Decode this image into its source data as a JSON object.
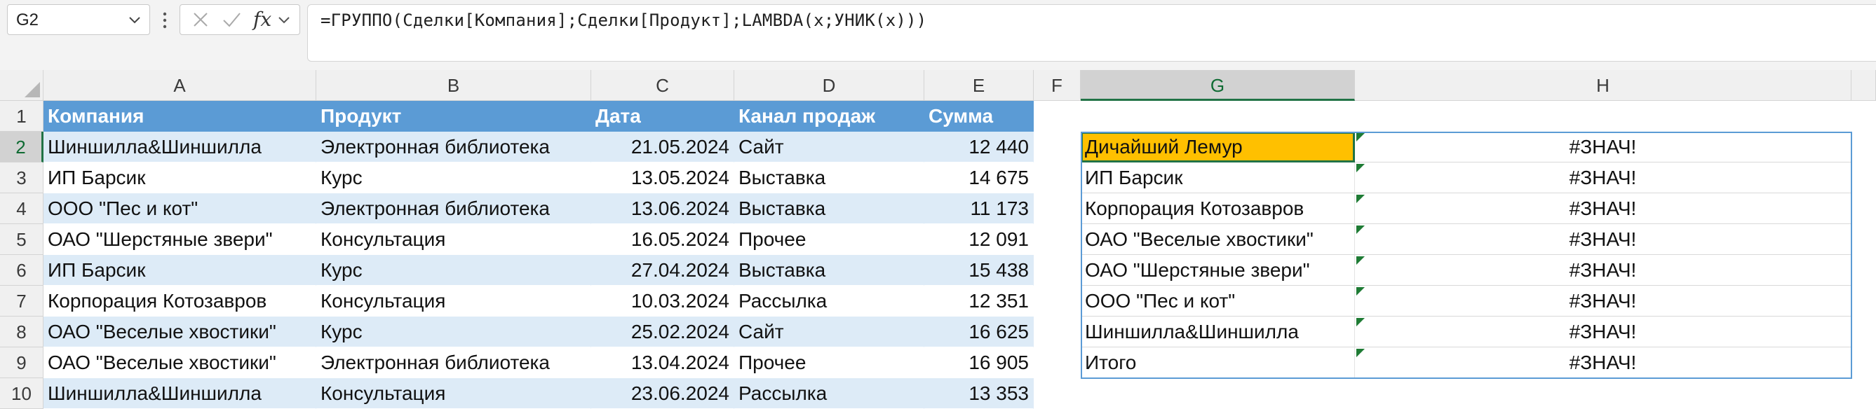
{
  "formula_bar": {
    "name_box": "G2",
    "formula": "=ГРУППО(Сделки[Компания];Сделки[Продукт];LAMBDA(x;УНИК(x)))",
    "fx_label": "fx"
  },
  "columns": [
    "A",
    "B",
    "C",
    "D",
    "E",
    "F",
    "G",
    "H"
  ],
  "rows": [
    "1",
    "2",
    "3",
    "4",
    "5",
    "6",
    "7",
    "8",
    "9",
    "10"
  ],
  "table": {
    "headers": [
      "Компания",
      "Продукт",
      "Дата",
      "Канал продаж",
      "Сумма"
    ],
    "rows": [
      [
        "Шиншилла&Шиншилла",
        "Электронная библиотека",
        "21.05.2024",
        "Сайт",
        "12 440"
      ],
      [
        "ИП Барсик",
        "Курс",
        "13.05.2024",
        "Выставка",
        "14 675"
      ],
      [
        "ООО \"Пес и кот\"",
        "Электронная библиотека",
        "13.06.2024",
        "Выставка",
        "11 173"
      ],
      [
        "ОАО \"Шерстяные звери\"",
        "Консультация",
        "16.05.2024",
        "Прочее",
        "12 091"
      ],
      [
        "ИП Барсик",
        "Курс",
        "27.04.2024",
        "Выставка",
        "15 438"
      ],
      [
        "Корпорация Котозавров",
        "Консультация",
        "10.03.2024",
        "Рассылка",
        "12 351"
      ],
      [
        "ОАО \"Веселые хвостики\"",
        "Курс",
        "25.02.2024",
        "Сайт",
        "16 625"
      ],
      [
        "ОАО \"Веселые хвостики\"",
        "Электронная библиотека",
        "13.04.2024",
        "Прочее",
        "16 905"
      ],
      [
        "Шиншилла&Шиншилла",
        "Консультация",
        "23.06.2024",
        "Рассылка",
        "13 353"
      ]
    ]
  },
  "result": {
    "g": [
      "Дичайший Лемур",
      "ИП Барсик",
      "Корпорация Котозавров",
      "ОАО \"Веселые хвостики\"",
      "ОАО \"Шерстяные звери\"",
      "ООО \"Пес и кот\"",
      "Шиншилла&Шиншилла",
      "Итого"
    ],
    "h": [
      "#ЗНАЧ!",
      "#ЗНАЧ!",
      "#ЗНАЧ!",
      "#ЗНАЧ!",
      "#ЗНАЧ!",
      "#ЗНАЧ!",
      "#ЗНАЧ!",
      "#ЗНАЧ!"
    ]
  },
  "colors": {
    "table_header": "#5b9bd5",
    "band": "#ddebf7",
    "active_fill": "#ffc000",
    "selection": "#217346"
  }
}
